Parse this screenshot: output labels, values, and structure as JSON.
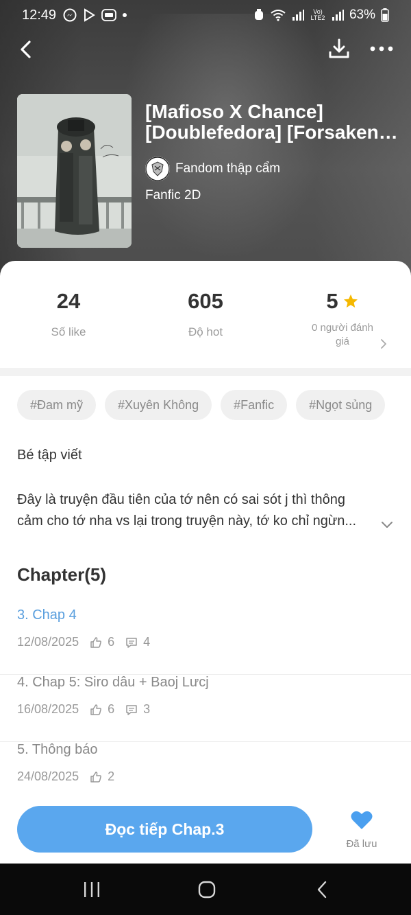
{
  "status_bar": {
    "time": "12:49",
    "network": "Vo) LTE2",
    "battery": "63%"
  },
  "story": {
    "title_line1": "[Mafioso X Chance]",
    "title_line2": "[Doublefedora] [Forsaken S...",
    "author": "Fandom thập cẩm",
    "category": "Fanfic 2D"
  },
  "stats": {
    "likes_value": "24",
    "likes_label": "Số like",
    "hot_value": "605",
    "hot_label": "Độ hot",
    "rating_value": "5",
    "rating_label": "0 người đánh giá"
  },
  "tags": [
    "#Đam mỹ",
    "#Xuyên Không",
    "#Fanfic",
    "#Ngọt sủng"
  ],
  "description": {
    "title": "Bé tập viết",
    "line1": "Đây là truyện đầu tiên của tớ nên có sai sót j thì thông",
    "line2": "cảm cho tớ nha vs lại trong truyện này, tớ ko chỉ ngừn..."
  },
  "chapters": {
    "heading": "Chapter(5)",
    "items": [
      {
        "name": "3. Chap 4",
        "date": "12/08/2025",
        "likes": "6",
        "comments": "4"
      },
      {
        "name": "4. Chap 5: Siro dâu + Baoj Lưcj",
        "date": "16/08/2025",
        "likes": "6",
        "comments": "3"
      },
      {
        "name": "5. Thông báo",
        "date": "24/08/2025",
        "likes": "2"
      }
    ]
  },
  "actions": {
    "continue_label": "Đọc tiếp Chap.3",
    "saved_label": "Đã lưu"
  },
  "colors": {
    "accent": "#5aa7ee",
    "active_chapter": "#5a9fde",
    "star": "#f5b800",
    "heart": "#4a9fef"
  }
}
